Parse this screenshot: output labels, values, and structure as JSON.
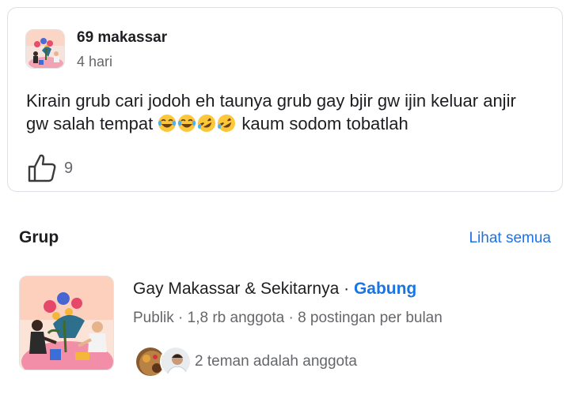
{
  "post": {
    "author": "69 makassar",
    "time": "4 hari",
    "text_before_emoji": "Kirain grub cari jodoh eh taunya grub gay bjir gw ijin keluar anjir gw salah tempat ",
    "emojis": [
      "tears-of-joy",
      "tears-of-joy",
      "rolling-laughing",
      "rolling-laughing"
    ],
    "text_after_emoji": " kaum sodom tobatlah",
    "like_count": "9",
    "like_icon": "thumbs-up-icon"
  },
  "groups_section": {
    "title": "Grup",
    "see_all": "Lihat semua",
    "group": {
      "name": "Gay Makassar & Sekitarnya",
      "separator": " · ",
      "join": "Gabung",
      "meta": "Publik · 1,8 rb anggota · 8 postingan per bulan",
      "friends_text": "2 teman adalah anggota"
    }
  },
  "colors": {
    "link_blue": "#1b74e4",
    "secondary_text": "#65676b",
    "card_border": "#dcdfe4"
  }
}
